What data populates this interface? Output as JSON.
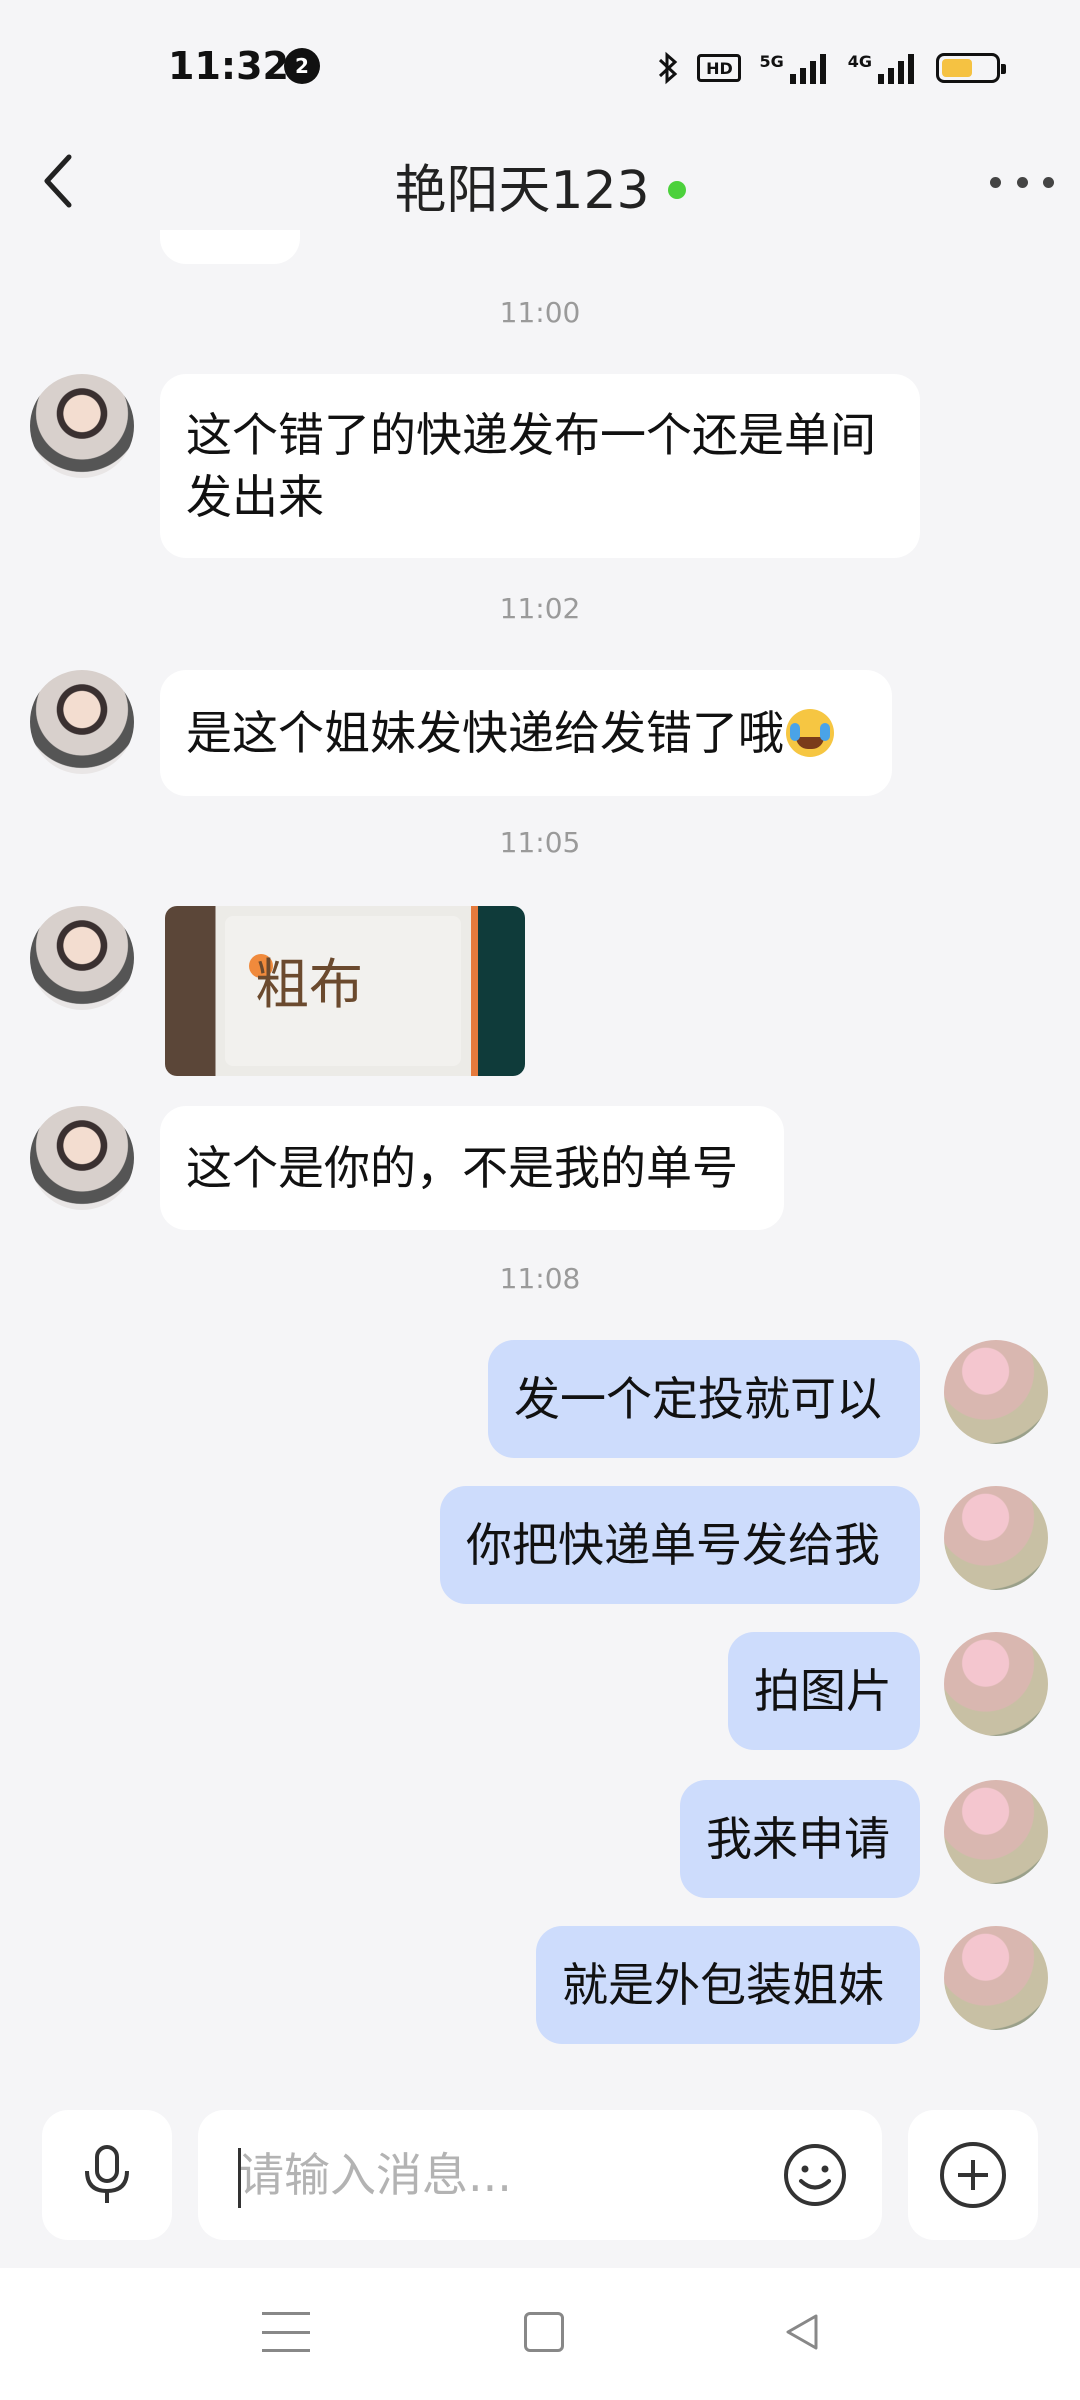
{
  "status_bar": {
    "time": "11:32",
    "notification_count": "2",
    "hd_label": "HD",
    "network_1": "5G",
    "network_2": "4G"
  },
  "header": {
    "title": "艳阳天123"
  },
  "messages": {
    "ts1": "11:00",
    "m1": "这个错了的快递发布一个还是单间发出来",
    "ts2": "11:02",
    "m2": "是这个姐妹发快递给发错了哦",
    "ts3": "11:05",
    "photo_text": "粗布",
    "m3": "这个是你的，不是我的单号",
    "ts4": "11:08",
    "r1": "发一个定投就可以",
    "r2": "你把快递单号发给我",
    "r3": "拍图片",
    "r4": "我来申请",
    "r5": "就是外包装姐妹"
  },
  "input": {
    "placeholder": "请输入消息..."
  },
  "colors": {
    "background": "#f5f5f7",
    "incoming_bubble": "#ffffff",
    "outgoing_bubble": "#cddcfc",
    "online_dot": "#4cd13c"
  },
  "icons": [
    "bluetooth-icon",
    "signal-icon",
    "battery-icon",
    "back-arrow-icon",
    "more-icon",
    "mic-icon",
    "smiley-icon",
    "plus-icon",
    "nav-menu-icon",
    "nav-home-icon",
    "nav-back-icon"
  ]
}
